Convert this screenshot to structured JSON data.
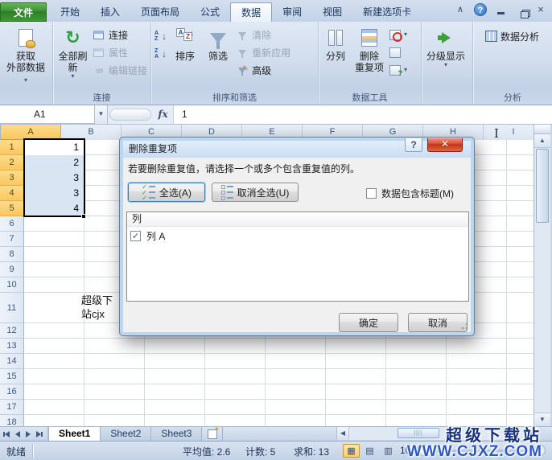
{
  "window": {
    "file_tab": "文件",
    "tabs": [
      "开始",
      "插入",
      "页面布局",
      "公式",
      "数据",
      "审阅",
      "视图",
      "新建选项卡"
    ],
    "selected_tab": "数据"
  },
  "ribbon": {
    "get_external_line1": "获取",
    "get_external_line2": "外部数据",
    "refresh_all": "全部刷新",
    "connections_btn": "连接",
    "properties_btn": "属性",
    "edit_links_btn": "编辑链接",
    "group_connections": "连接",
    "sort_btn": "排序",
    "filter_btn": "筛选",
    "clear_btn": "清除",
    "reapply_btn": "重新应用",
    "advanced_btn": "高级",
    "group_sort_filter": "排序和筛选",
    "text_to_columns_btn": "分列",
    "remove_dup_line1": "删除",
    "remove_dup_line2": "重复项",
    "group_data_tools": "数据工具",
    "outline_btn": "分级显示",
    "data_analysis_btn": "数据分析",
    "group_analysis": "分析"
  },
  "formula_bar": {
    "name_box": "A1",
    "fx_label": "fx",
    "content": "1"
  },
  "grid": {
    "columns": [
      "A",
      "B",
      "C",
      "D",
      "E",
      "F",
      "G",
      "H",
      "I"
    ],
    "rows": [
      "1",
      "2",
      "3",
      "4",
      "5",
      "6",
      "7",
      "8",
      "9",
      "10",
      "11",
      "12",
      "13",
      "14",
      "15",
      "16",
      "17",
      "18"
    ],
    "values": [
      "1",
      "2",
      "3",
      "3",
      "4"
    ],
    "cell_text_line1": "超级下",
    "cell_text_line2": "站cjx"
  },
  "dialog": {
    "title": "删除重复项",
    "description": "若要删除重复值，请选择一个或多个包含重复值的列。",
    "select_all": "全选(A)",
    "unselect_all": "取消全选(U)",
    "headers_checkbox": "数据包含标题(M)",
    "list_header": "列",
    "list_item": "列 A",
    "ok": "确定",
    "cancel": "取消",
    "check_glyph": "✓"
  },
  "sheet_bar": {
    "tabs": [
      "Sheet1",
      "Sheet2",
      "Sheet3"
    ],
    "active": "Sheet1"
  },
  "status_bar": {
    "mode": "就绪",
    "average": "平均值: 2.6",
    "count": "计数: 5",
    "sum": "求和: 13",
    "zoom": "100%"
  },
  "watermark": {
    "line1": "超级下载站",
    "line2": "WWW.CJXZ.COM"
  },
  "colors": {
    "header_selected": "#f9c75f",
    "selection_fill": "#d9e5f3",
    "file_tab_green": "#3c8f33",
    "close_red": "#c03218",
    "help_blue": "#2f6fc0"
  }
}
